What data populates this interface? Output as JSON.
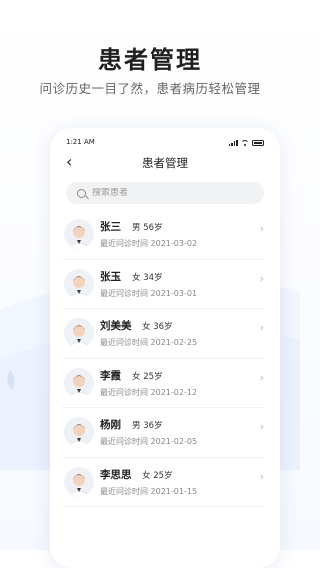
{
  "promo": {
    "title": "患者管理",
    "subtitle": "问诊历史一目了然，患者病历轻松管理"
  },
  "status_bar": {
    "time": "1:21 AM"
  },
  "header": {
    "back_icon": "chevron-left-icon",
    "title": "患者管理"
  },
  "search": {
    "placeholder": "搜索患者",
    "value": ""
  },
  "visit_label": "最近问诊时间",
  "patients": [
    {
      "name": "张三",
      "info": "男 56岁",
      "visit": "最近问诊时间 2021-03-02"
    },
    {
      "name": "张玉",
      "info": "女 34岁",
      "visit": "最近问诊时间 2021-03-01"
    },
    {
      "name": "刘美美",
      "info": "女 36岁",
      "visit": "最近问诊时间 2021-02-25"
    },
    {
      "name": "李霞",
      "info": "女 25岁",
      "visit": "最近问诊时间 2021-02-12"
    },
    {
      "name": "杨刚",
      "info": "男 36岁",
      "visit": "最近问诊时间 2021-02-05"
    },
    {
      "name": "李思思",
      "info": "女 25岁",
      "visit": "最近问诊时间 2021-01-15"
    }
  ],
  "colors": {
    "accent_bg": "#eaf1ff",
    "text_primary": "#222222",
    "text_secondary": "#888888"
  }
}
